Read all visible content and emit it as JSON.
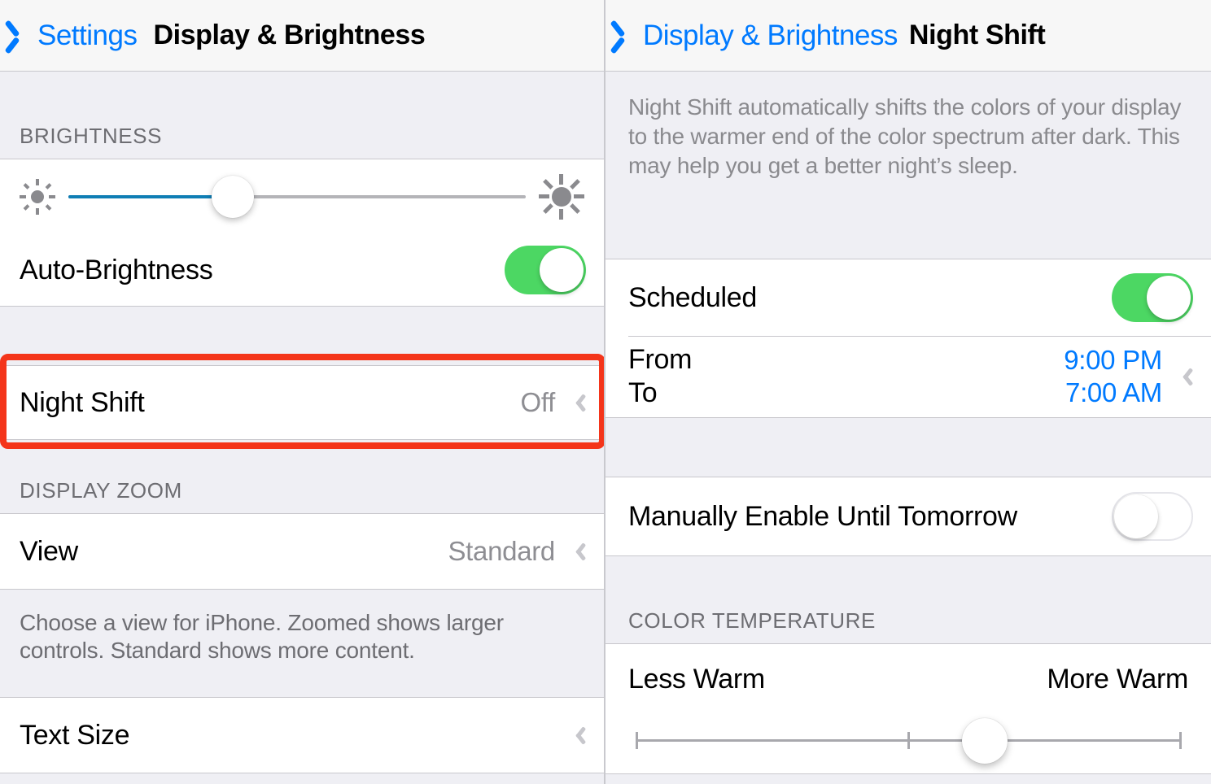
{
  "left_panel": {
    "nav": {
      "back_label": "Settings",
      "back_icon": "chevron-left-icon",
      "title": "Display & Brightness"
    },
    "brightness_section": {
      "header": "BRIGHTNESS",
      "slider": {
        "low_icon": "sun-small-icon",
        "high_icon": "sun-large-icon",
        "value_percent": 36
      },
      "auto_brightness": {
        "label": "Auto-Brightness",
        "toggle_state": "on"
      }
    },
    "night_shift_row": {
      "label": "Night Shift",
      "value": "Off",
      "chevron_icon": "chevron-right-icon",
      "highlighted": true
    },
    "display_zoom_section": {
      "header": "DISPLAY ZOOM",
      "view_row": {
        "label": "View",
        "value": "Standard",
        "chevron_icon": "chevron-right-icon"
      },
      "footer_note": "Choose a view for iPhone. Zoomed shows larger controls. Standard shows more content."
    },
    "text_size_row": {
      "label": "Text Size",
      "chevron_icon": "chevron-right-icon"
    }
  },
  "right_panel": {
    "nav": {
      "back_label": "Display & Brightness",
      "back_icon": "chevron-left-icon",
      "title": "Night Shift"
    },
    "description": "Night Shift automatically shifts the colors of your display to the warmer end of the color spectrum after dark. This may help you get a better night’s sleep.",
    "scheduled_row": {
      "label": "Scheduled",
      "toggle_state": "on"
    },
    "schedule_row": {
      "from_label": "From",
      "from_value": "9:00 PM",
      "to_label": "To",
      "to_value": "7:00 AM",
      "chevron_icon": "chevron-right-icon"
    },
    "manual_row": {
      "label": "Manually Enable Until Tomorrow",
      "toggle_state": "off"
    },
    "color_temperature_section": {
      "header": "COLOR TEMPERATURE",
      "left_label": "Less Warm",
      "right_label": "More Warm",
      "value_percent": 64,
      "tick_percents": [
        0,
        50,
        100
      ]
    }
  },
  "annotation": {
    "color": "#F4351A",
    "target": "night-shift-row"
  }
}
